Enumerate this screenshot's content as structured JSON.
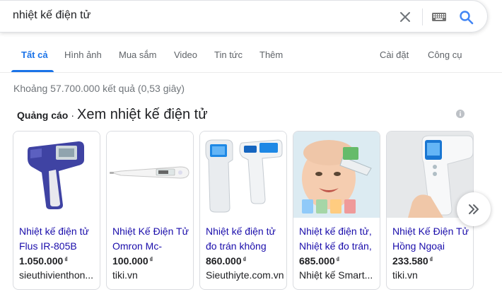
{
  "search": {
    "query": "nhiệt kế điện tử"
  },
  "tabs": [
    {
      "label": "Tất cả",
      "active": true
    },
    {
      "label": "Hình ảnh"
    },
    {
      "label": "Mua sắm"
    },
    {
      "label": "Video"
    },
    {
      "label": "Tin tức"
    },
    {
      "label": "Thêm"
    },
    {
      "label": "Cài đặt"
    },
    {
      "label": "Công cụ"
    }
  ],
  "result_stats": "Khoảng 57.700.000 kết quả (0,53 giây)",
  "ads": {
    "label": "Quảng cáo",
    "separator": "·",
    "title": "Xem nhiệt kế điện tử"
  },
  "products": [
    {
      "name": "Nhiệt kế điện tử Flus IR-805B",
      "price": "1.050.000",
      "currency": "₫",
      "store": "sieuthivienthon..."
    },
    {
      "name": "Nhiệt Kế Điện Tử Omron Mc-",
      "price": "100.000",
      "currency": "₫",
      "store": "tiki.vn"
    },
    {
      "name": "Nhiệt kế điện tử đo trán không",
      "price": "860.000",
      "currency": "₫",
      "store": "Sieuthiyte.com.vn"
    },
    {
      "name": "Nhiệt kế điện tử, Nhiệt kế đo trán,",
      "price": "685.000",
      "currency": "₫",
      "store": "Nhiệt kế Smart..."
    },
    {
      "name": "Nhiệt Kế Điện Tử Hồng Ngoại",
      "price": "233.580",
      "currency": "₫",
      "store": "tiki.vn"
    }
  ],
  "colors": {
    "accent": "#1a73e8",
    "link": "#1a0dab",
    "muted": "#70757a"
  }
}
